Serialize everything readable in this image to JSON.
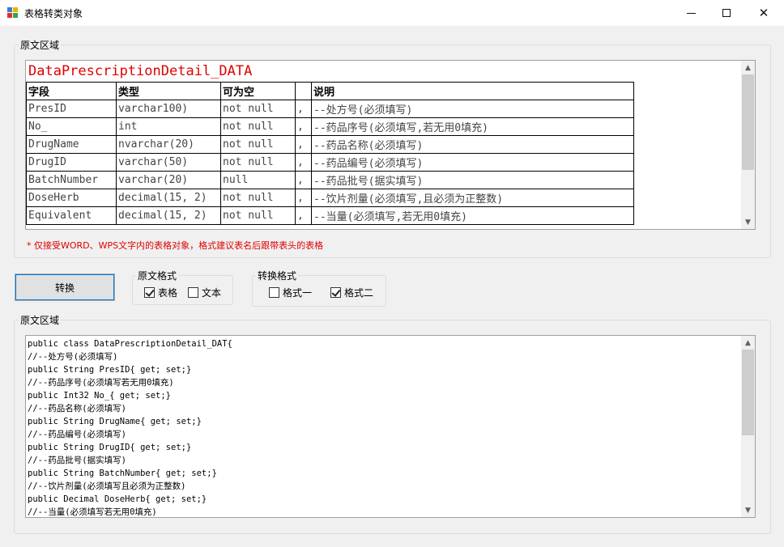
{
  "window": {
    "title": "表格转类对象",
    "controls": {
      "minimize": "—",
      "maximize": "☐",
      "close": "✕"
    }
  },
  "source_group": {
    "label": "原文区域"
  },
  "table_doc": {
    "title": "DataPrescriptionDetail_DATA",
    "headers": [
      "字段",
      "类型",
      "可为空",
      "",
      "说明"
    ],
    "rows": [
      [
        "PresID",
        "varchar100)",
        "not null",
        ",",
        "--处方号(必须填写)"
      ],
      [
        "No_",
        "int",
        "not null",
        ",",
        "--药品序号(必须填写,若无用0填充)"
      ],
      [
        "DrugName",
        "nvarchar(20)",
        "not null",
        ",",
        "--药品名称(必须填写)"
      ],
      [
        "DrugID",
        "varchar(50)",
        "not null",
        ",",
        "--药品编号(必须填写)"
      ],
      [
        "BatchNumber",
        "varchar(20)",
        "null",
        ",",
        "--药品批号(据实填写)"
      ],
      [
        "DoseHerb",
        "decimal(15, 2)",
        "not null",
        ",",
        "--饮片剂量(必须填写,且必须为正整数)"
      ],
      [
        "Equivalent",
        "decimal(15, 2)",
        "not null",
        ",",
        "--当量(必须填写,若无用0填充)"
      ]
    ]
  },
  "warning": "* 仅接受WORD、WPS文字内的表格对象，格式建议表名后跟带表头的表格",
  "convert_button": "转换",
  "source_format": {
    "label": "原文格式",
    "options": [
      {
        "label": "表格",
        "checked": true
      },
      {
        "label": "文本",
        "checked": false
      }
    ]
  },
  "convert_format": {
    "label": "转换格式",
    "options": [
      {
        "label": "格式一",
        "checked": false
      },
      {
        "label": "格式二",
        "checked": true
      }
    ]
  },
  "output_group": {
    "label": "原文区域"
  },
  "code_lines": [
    "public class DataPrescriptionDetail_DAT{",
    "//--处方号(必须填写)",
    "public String PresID{ get; set;}",
    "//--药品序号(必须填写若无用0填充)",
    "public Int32 No_{ get; set;}",
    "//--药品名称(必须填写)",
    "public String DrugName{ get; set;}",
    "//--药品编号(必须填写)",
    "public String DrugID{ get; set;}",
    "//--药品批号(据实填写)",
    "public String BatchNumber{ get; set;}",
    "//--饮片剂量(必须填写且必须为正整数)",
    "public Decimal DoseHerb{ get; set;}",
    "//--当量(必须填写若无用0填充)"
  ]
}
